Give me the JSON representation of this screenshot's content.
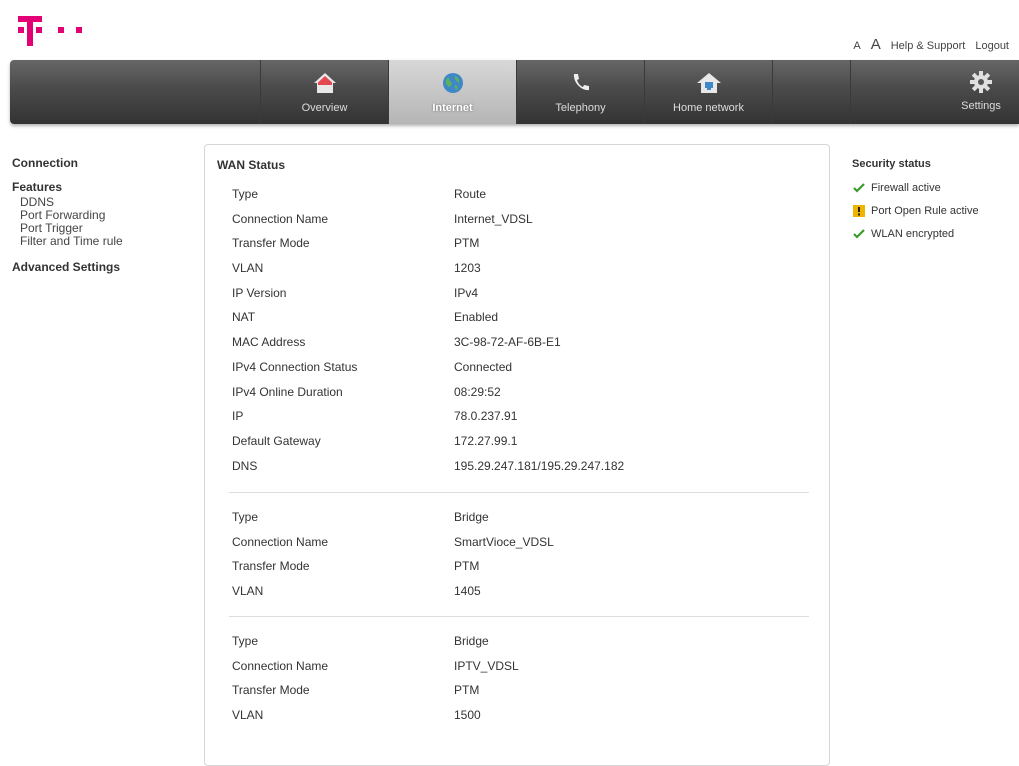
{
  "header": {
    "font_small": "A",
    "font_large": "A",
    "help": "Help & Support",
    "logout": "Logout",
    "brand_color": "#e20074"
  },
  "nav": {
    "items": [
      {
        "label": "Overview",
        "icon": "home-icon"
      },
      {
        "label": "Internet",
        "icon": "globe-icon",
        "active": true
      },
      {
        "label": "Telephony",
        "icon": "phone-icon"
      },
      {
        "label": "Home network",
        "icon": "home-network-icon"
      }
    ],
    "settings": {
      "label": "Settings",
      "icon": "gear-icon"
    }
  },
  "sidebar": {
    "connection": "Connection",
    "features": "Features",
    "sub_items": [
      "DDNS",
      "Port Forwarding",
      "Port Trigger",
      "Filter and Time rule"
    ],
    "advanced": "Advanced Settings"
  },
  "wan": {
    "title": "WAN Status",
    "groups": [
      [
        {
          "k": "Type",
          "v": "Route"
        },
        {
          "k": "Connection Name",
          "v": "Internet_VDSL"
        },
        {
          "k": "Transfer Mode",
          "v": "PTM"
        },
        {
          "k": "VLAN",
          "v": "1203"
        },
        {
          "k": "IP Version",
          "v": "IPv4"
        },
        {
          "k": "NAT",
          "v": "Enabled"
        },
        {
          "k": "MAC Address",
          "v": "3C-98-72-AF-6B-E1"
        },
        {
          "k": "IPv4 Connection Status",
          "v": "Connected"
        },
        {
          "k": "IPv4 Online Duration",
          "v": "08:29:52"
        },
        {
          "k": "IP",
          "v": "78.0.237.91"
        },
        {
          "k": "Default Gateway",
          "v": "172.27.99.1"
        },
        {
          "k": "DNS",
          "v": "195.29.247.181/195.29.247.182"
        }
      ],
      [
        {
          "k": "Type",
          "v": "Bridge"
        },
        {
          "k": "Connection Name",
          "v": "SmartVioce_VDSL"
        },
        {
          "k": "Transfer Mode",
          "v": "PTM"
        },
        {
          "k": "VLAN",
          "v": "1405"
        }
      ],
      [
        {
          "k": "Type",
          "v": "Bridge"
        },
        {
          "k": "Connection Name",
          "v": "IPTV_VDSL"
        },
        {
          "k": "Transfer Mode",
          "v": "PTM"
        },
        {
          "k": "VLAN",
          "v": "1500"
        }
      ]
    ]
  },
  "security": {
    "title": "Security status",
    "items": [
      {
        "label": "Firewall active",
        "icon": "check-icon"
      },
      {
        "label": "Port Open Rule active",
        "icon": "warning-icon"
      },
      {
        "label": "WLAN encrypted",
        "icon": "check-icon"
      }
    ]
  }
}
